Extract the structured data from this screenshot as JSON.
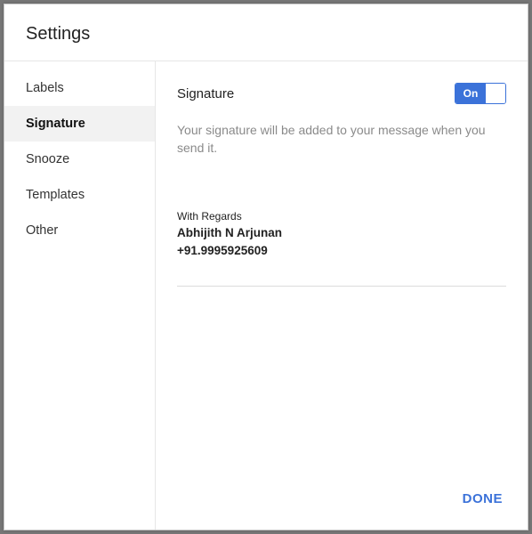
{
  "header": {
    "title": "Settings"
  },
  "sidebar": {
    "items": [
      {
        "label": "Labels"
      },
      {
        "label": "Signature"
      },
      {
        "label": "Snooze"
      },
      {
        "label": "Templates"
      },
      {
        "label": "Other"
      }
    ],
    "active_index": 1
  },
  "main": {
    "section_title": "Signature",
    "toggle": {
      "state_label": "On",
      "on": true
    },
    "description": "Your signature will be added to your message when you send it.",
    "signature": {
      "line1": "With Regards",
      "line2": "Abhijith N Arjunan",
      "line3": "+91.9995925609"
    },
    "done_label": "DONE"
  }
}
